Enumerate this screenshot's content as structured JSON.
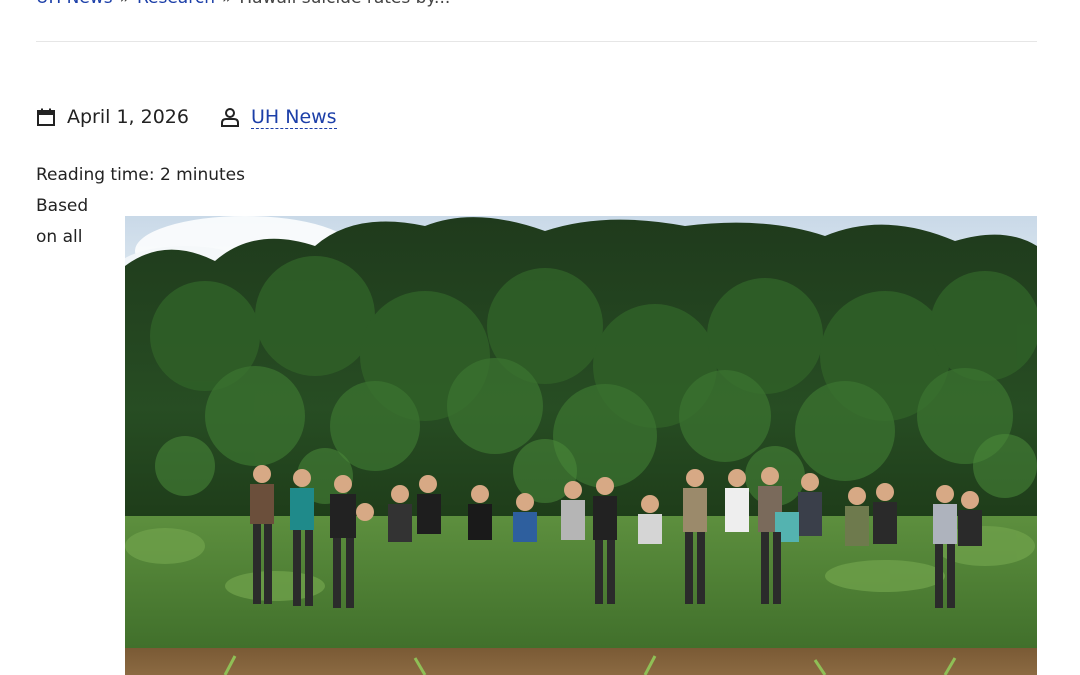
{
  "breadcrumb": {
    "items": [
      "UH News",
      "Research",
      "Hawaii suicide rates by..."
    ],
    "separator": "»"
  },
  "meta": {
    "date": "April 1, 2026",
    "author": "UH News",
    "date_icon": "calendar-icon",
    "author_icon": "user-icon"
  },
  "reading_time": "Reading time: 2 minutes",
  "side_text": {
    "line1": "Based",
    "line2": "on all"
  },
  "colors": {
    "link": "#1c3fa8",
    "text": "#222222"
  }
}
